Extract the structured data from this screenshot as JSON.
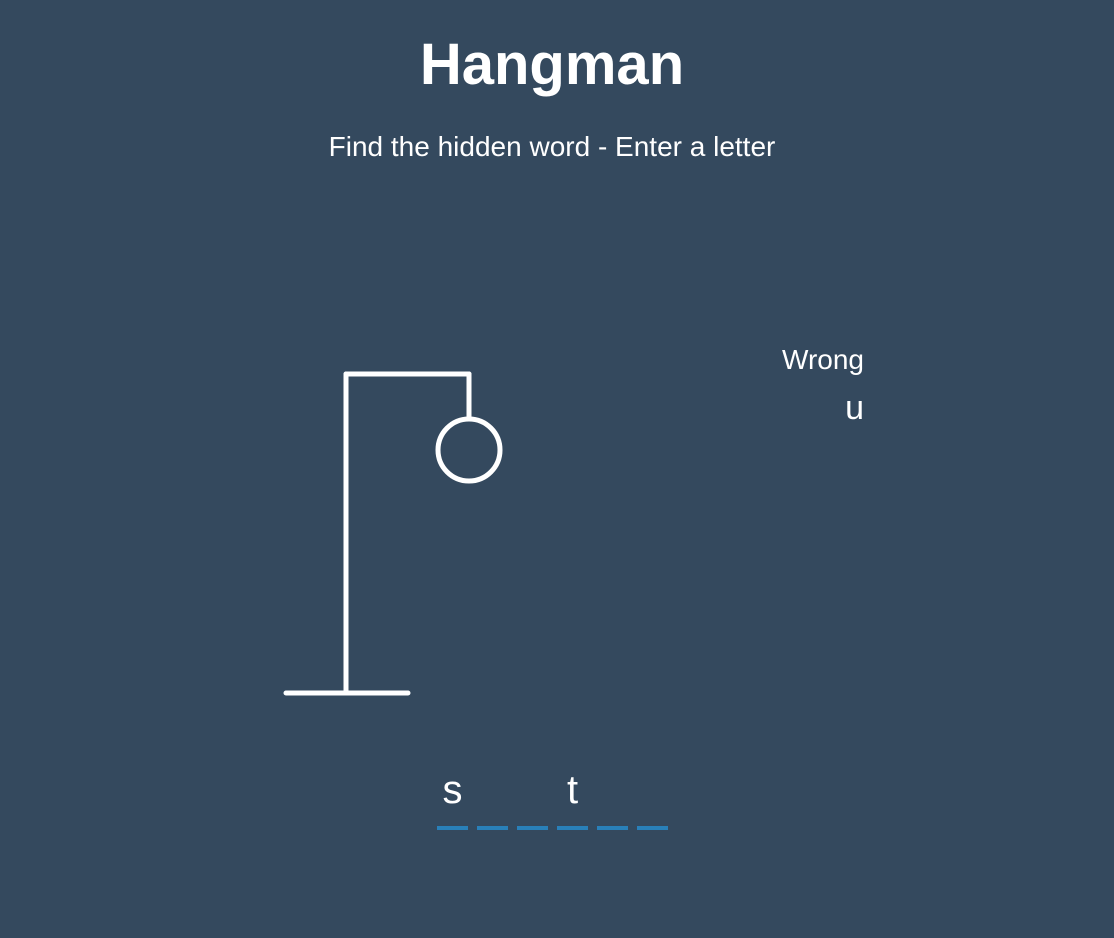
{
  "header": {
    "title": "Hangman",
    "subtitle": "Find the hidden word - Enter a letter"
  },
  "wrong": {
    "label": "Wrong",
    "letters": [
      "u"
    ]
  },
  "word": {
    "slots": [
      "s",
      "",
      "",
      "t",
      "",
      ""
    ]
  },
  "figure": {
    "parts_shown": [
      "base",
      "pole",
      "beam",
      "rope",
      "head"
    ]
  },
  "colors": {
    "background": "#34495e",
    "foreground": "#ffffff",
    "underline": "#2980b9"
  }
}
